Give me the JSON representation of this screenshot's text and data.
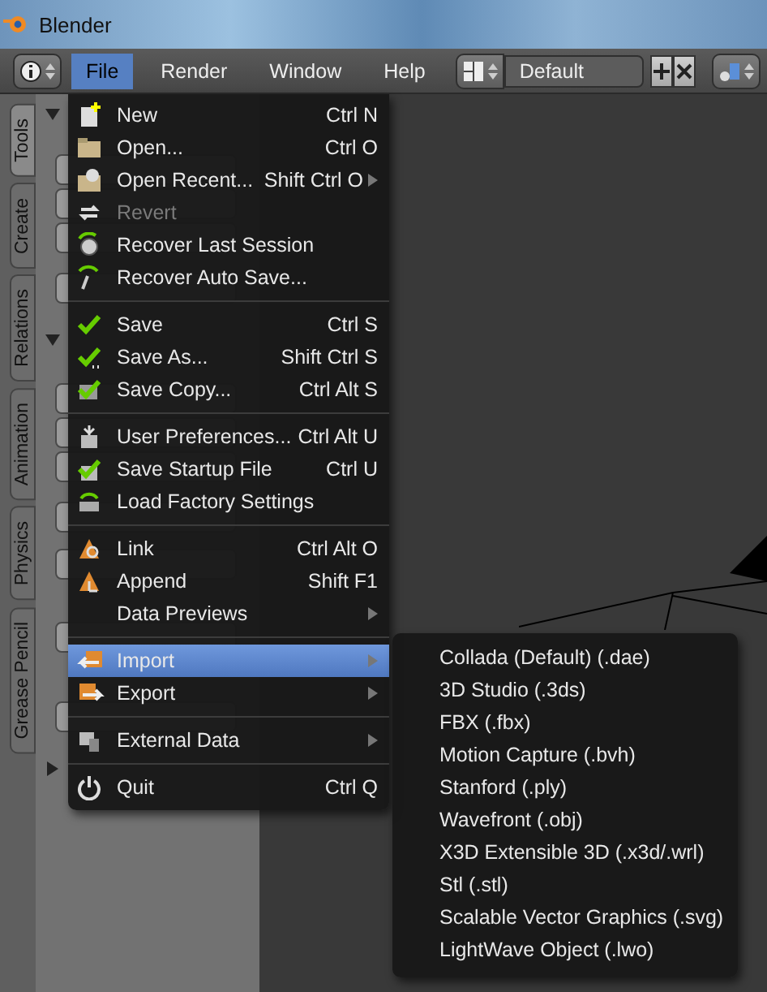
{
  "window": {
    "title": "Blender"
  },
  "header": {
    "menus": [
      {
        "label": "File",
        "selected": true
      },
      {
        "label": "Render",
        "selected": false
      },
      {
        "label": "Window",
        "selected": false
      },
      {
        "label": "Help",
        "selected": false
      }
    ],
    "layout": "Default"
  },
  "tool_tabs": [
    {
      "label": "Tools",
      "selected": true
    },
    {
      "label": "Create",
      "selected": false
    },
    {
      "label": "Relations",
      "selected": false
    },
    {
      "label": "Animation",
      "selected": false
    },
    {
      "label": "Physics",
      "selected": false
    },
    {
      "label": "Grease Pencil",
      "selected": false
    }
  ],
  "file_menu": {
    "sections": [
      [
        {
          "label": "New",
          "shortcut": "Ctrl N",
          "disabled": false,
          "submenu": false,
          "selected": false
        },
        {
          "label": "Open...",
          "shortcut": "Ctrl O",
          "disabled": false,
          "submenu": false,
          "selected": false
        },
        {
          "label": "Open Recent...",
          "shortcut": "Shift Ctrl O",
          "disabled": false,
          "submenu": true,
          "selected": false
        },
        {
          "label": "Revert",
          "disabled": true,
          "submenu": false,
          "selected": false
        },
        {
          "label": "Recover Last Session",
          "disabled": false,
          "submenu": false,
          "selected": false
        },
        {
          "label": "Recover Auto Save...",
          "disabled": false,
          "submenu": false,
          "selected": false
        }
      ],
      [
        {
          "label": "Save",
          "shortcut": "Ctrl S",
          "disabled": false,
          "submenu": false,
          "selected": false
        },
        {
          "label": "Save As...",
          "shortcut": "Shift Ctrl S",
          "disabled": false,
          "submenu": false,
          "selected": false
        },
        {
          "label": "Save Copy...",
          "shortcut": "Ctrl Alt S",
          "disabled": false,
          "submenu": false,
          "selected": false
        }
      ],
      [
        {
          "label": "User Preferences...",
          "shortcut": "Ctrl Alt U",
          "disabled": false,
          "submenu": false,
          "selected": false
        },
        {
          "label": "Save Startup File",
          "shortcut": "Ctrl U",
          "disabled": false,
          "submenu": false,
          "selected": false
        },
        {
          "label": "Load Factory Settings",
          "disabled": false,
          "submenu": false,
          "selected": false
        }
      ],
      [
        {
          "label": "Link",
          "shortcut": "Ctrl Alt O",
          "disabled": false,
          "submenu": false,
          "selected": false
        },
        {
          "label": "Append",
          "shortcut": "Shift F1",
          "disabled": false,
          "submenu": false,
          "selected": false
        },
        {
          "label": "Data Previews",
          "disabled": false,
          "submenu": true,
          "selected": false
        }
      ],
      [
        {
          "label": "Import",
          "disabled": false,
          "submenu": true,
          "selected": true
        },
        {
          "label": "Export",
          "disabled": false,
          "submenu": true,
          "selected": false
        }
      ],
      [
        {
          "label": "External Data",
          "disabled": false,
          "submenu": true,
          "selected": false
        }
      ],
      [
        {
          "label": "Quit",
          "shortcut": "Ctrl Q",
          "disabled": false,
          "submenu": false,
          "selected": false
        }
      ]
    ]
  },
  "import_submenu": {
    "items": [
      "Collada (Default) (.dae)",
      "3D Studio (.3ds)",
      "FBX (.fbx)",
      "Motion Capture (.bvh)",
      "Stanford (.ply)",
      "Wavefront (.obj)",
      "X3D Extensible 3D (.x3d/.wrl)",
      "Stl (.stl)",
      "Scalable Vector Graphics (.svg)",
      "LightWave Object (.lwo)"
    ]
  }
}
